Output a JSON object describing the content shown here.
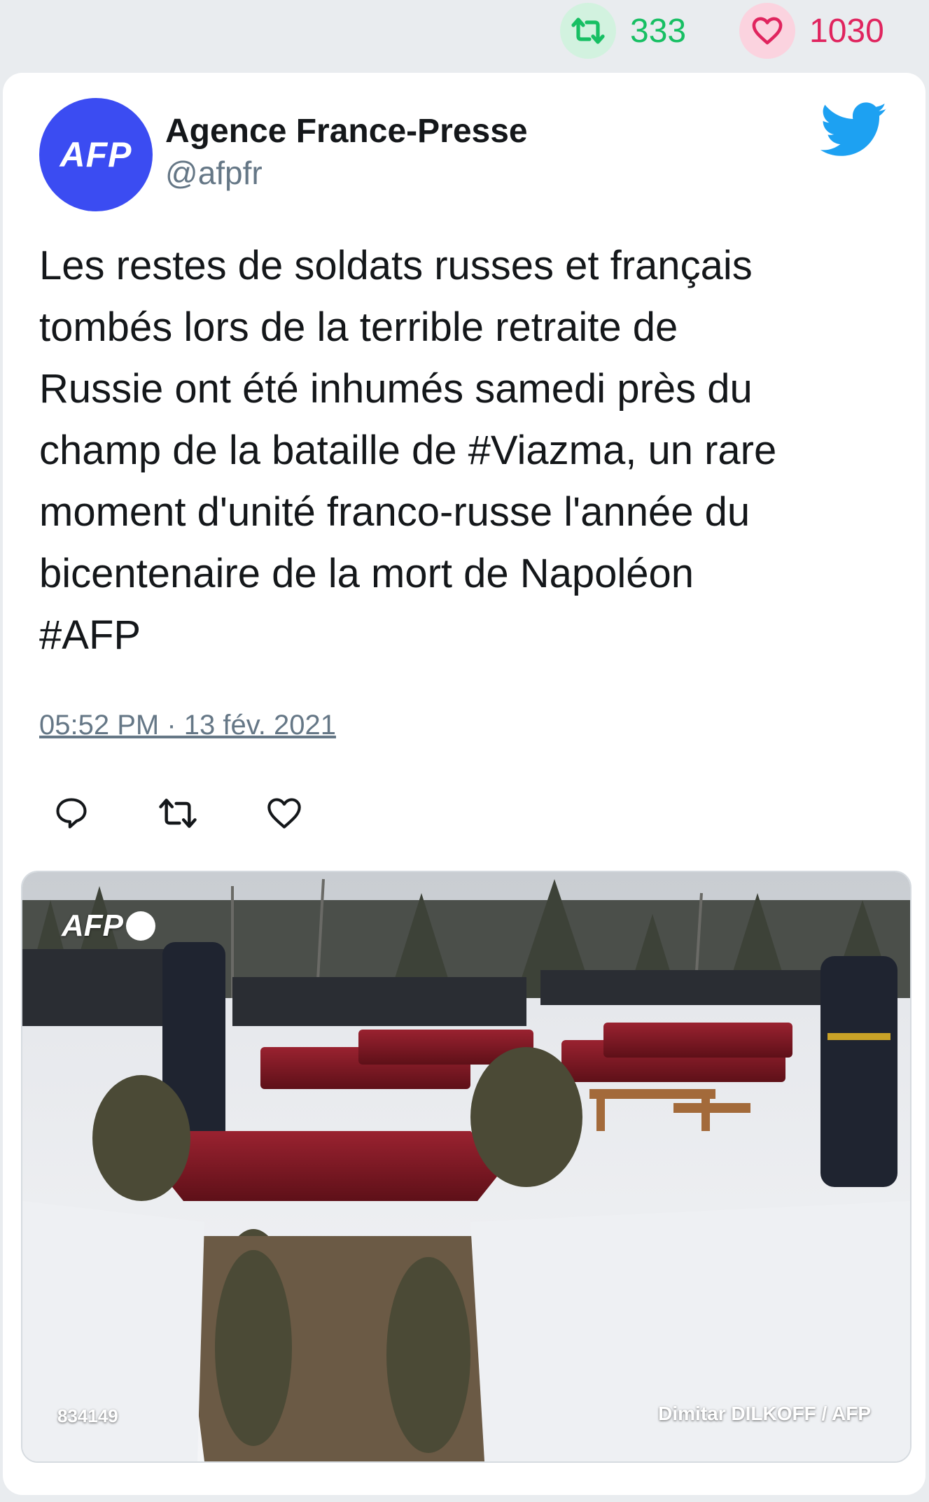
{
  "stats": {
    "retweets": "333",
    "likes": "1030",
    "retweet_icon": "retweet-icon",
    "like_icon": "heart-icon",
    "retweet_color": "#17bf63",
    "like_color": "#e0245e"
  },
  "author": {
    "name": "Agence France-Presse",
    "handle": "@afpfr",
    "avatar_text": "AFP",
    "avatar_color": "#3b4cf2"
  },
  "tweet": {
    "text": "Les restes de soldats russes et français\ntombés lors de la terrible retraite de\nRussie ont été inhumés samedi près du\nchamp de la bataille de #Viazma, un rare\nmoment d'unité franco-russe l'année du\nbicentenaire de la mort de Napoléon\n#AFP",
    "timestamp": "05:52 PM · 13 fév. 2021"
  },
  "actions": [
    {
      "icon": "reply-icon"
    },
    {
      "icon": "retweet-icon"
    },
    {
      "icon": "like-icon"
    }
  ],
  "photo": {
    "agency_watermark": "AFP",
    "photo_id": "834149",
    "credit": "Dimitar DILKOFF / AFP"
  },
  "brand": {
    "twitter_color": "#1da1f2"
  }
}
